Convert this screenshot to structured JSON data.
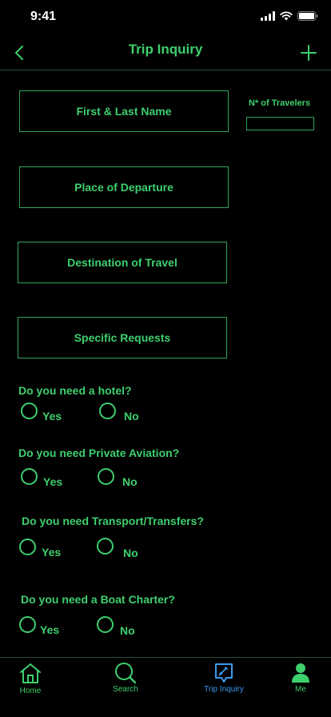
{
  "status": {
    "time": "9:41"
  },
  "nav": {
    "title": "Trip Inquiry"
  },
  "form": {
    "name_placeholder": "First & Last Name",
    "travelers_label": "N* of Travelers",
    "departure_placeholder": "Place of Departure",
    "destination_placeholder": "Destination of Travel",
    "requests_placeholder": "Specific Requests"
  },
  "questions": [
    {
      "text": "Do you need a hotel?",
      "yes": "Yes",
      "no": "No"
    },
    {
      "text": "Do you need Private Aviation?",
      "yes": "Yes",
      "no": "No"
    },
    {
      "text": "Do you need Transport/Transfers?",
      "yes": "Yes",
      "no": "No"
    },
    {
      "text": "Do you need a Boat Charter?",
      "yes": "Yes",
      "no": "No"
    }
  ],
  "tabs": [
    {
      "label": "Home",
      "icon": "home-icon",
      "color": "#3ecf6e"
    },
    {
      "label": "Search",
      "icon": "search-icon",
      "color": "#3ecf6e"
    },
    {
      "label": "Trip Inquiry",
      "icon": "edit-icon",
      "color": "#3b9bf0"
    },
    {
      "label": "Me",
      "icon": "person-icon",
      "color": "#3ecf6e"
    }
  ],
  "colors": {
    "accent": "#3ecf6e",
    "border": "#2fa55a",
    "active_tab": "#3b9bf0",
    "background": "#000000"
  }
}
